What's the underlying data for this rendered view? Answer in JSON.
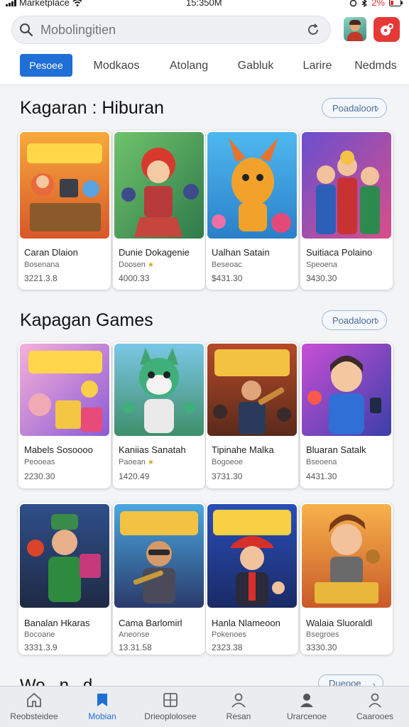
{
  "status_bar": {
    "left_label": "Marketplace",
    "time": "15:350M",
    "battery": "2%"
  },
  "search": {
    "placeholder": "Mobolingitien"
  },
  "tabs": [
    {
      "label": "Pesoee",
      "active": true
    },
    {
      "label": "Modkaos"
    },
    {
      "label": "Atolang"
    },
    {
      "label": "Gabluk"
    },
    {
      "label": "Larire"
    },
    {
      "label": "Nedmds"
    }
  ],
  "sections": [
    {
      "title": "Kagaran : Hiburan",
      "button": "Poadaloort",
      "items": [
        {
          "name": "Caran Dlaion",
          "sub": "Bosenana",
          "price": "3221.3.8"
        },
        {
          "name": "Dunie Dokagenie",
          "sub": "Doosen",
          "price": "4000.33",
          "starred": true
        },
        {
          "name": "Ualhan Satain",
          "sub": "Beseoac",
          "price": "$431.30"
        },
        {
          "name": "Suitiaca Polaino",
          "sub": "Speoena",
          "price": "3430.30"
        }
      ]
    },
    {
      "title": "Kapagan Games",
      "button": "Poadaloort",
      "items": [
        {
          "name": "Mabels Sosoooo",
          "sub": "Peooeas",
          "price": "2230.30"
        },
        {
          "name": "Kaniias Sanatah",
          "sub": "Paoean",
          "price": "1420.49",
          "starred": true
        },
        {
          "name": "Tipinahe Malka",
          "sub": "Bogoeoe",
          "price": "3731.30"
        },
        {
          "name": "Bluaran Satalk",
          "sub": "Bseoena",
          "price": "4431.30"
        }
      ]
    },
    {
      "items": [
        {
          "name": "Banalan Hkaras",
          "sub": "Bocoane",
          "price": "3331.3.9"
        },
        {
          "name": "Cama Barlomirl",
          "sub": "Aneonse",
          "price": "13.31.58"
        },
        {
          "name": "Hanla Nlameoon",
          "sub": "Pokenoes",
          "price": "2323.38"
        },
        {
          "name": "Walaia Sluoraldl",
          "sub": "Bsegroes",
          "price": "3330.30"
        }
      ]
    }
  ],
  "peek": {
    "title": "Wo...n...d",
    "button": "Dueooe"
  },
  "bottom_nav": [
    {
      "label": "Reobsteidee",
      "icon": "home-icon"
    },
    {
      "label": "Mobian",
      "icon": "tag-icon",
      "active": true
    },
    {
      "label": "Drieoplolosee",
      "icon": "dashboard-icon"
    },
    {
      "label": "Resan",
      "icon": "person-icon"
    },
    {
      "label": "Urarcenoe",
      "icon": "person-filled-icon"
    },
    {
      "label": "Caarooes",
      "icon": "profile-icon"
    }
  ]
}
